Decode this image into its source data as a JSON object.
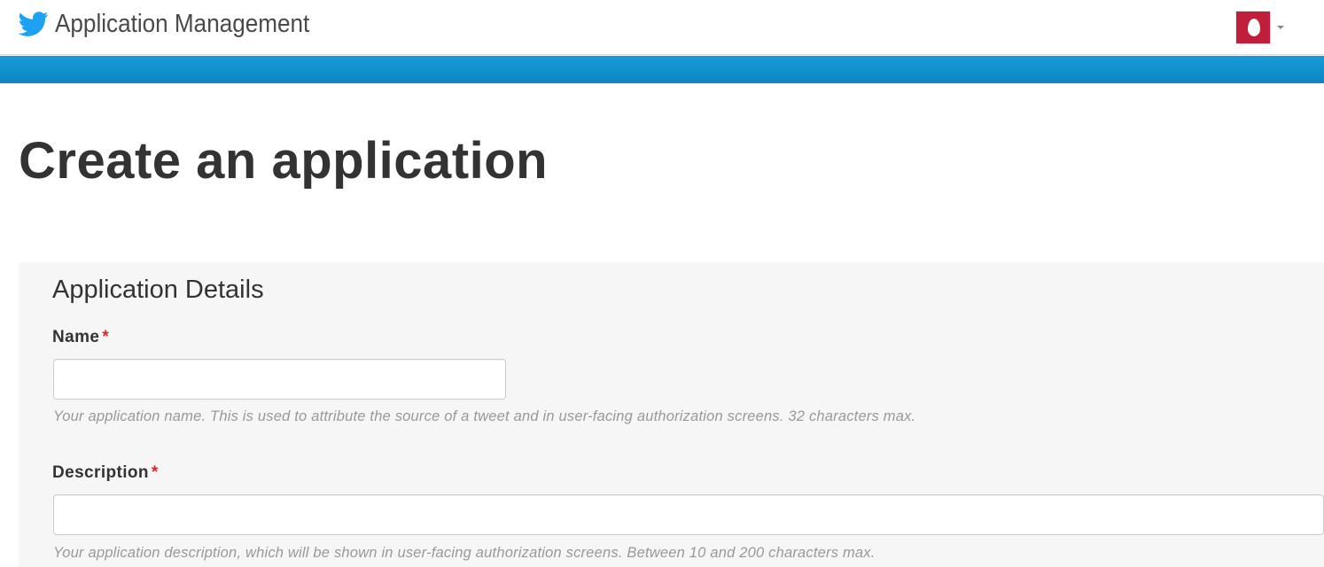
{
  "header": {
    "brand_icon": "twitter-bird-icon",
    "title": "Application Management",
    "account": {
      "avatar_icon": "default-egg-avatar-icon",
      "menu_icon": "caret-down-icon"
    }
  },
  "colors": {
    "accent_band": "#0f8fcf",
    "brand_blue": "#1da1f2",
    "required_mark": "#d9262c",
    "avatar_bg": "#c01e3a"
  },
  "page": {
    "title": "Create an application"
  },
  "form": {
    "section_title": "Application Details",
    "required_marker": "*",
    "fields": [
      {
        "label": "Name",
        "value": "",
        "help": "Your application name. This is used to attribute the source of a tweet and in user-facing authorization screens. 32 characters max."
      },
      {
        "label": "Description",
        "value": "",
        "help": "Your application description, which will be shown in user-facing authorization screens. Between 10 and 200 characters max."
      }
    ]
  }
}
